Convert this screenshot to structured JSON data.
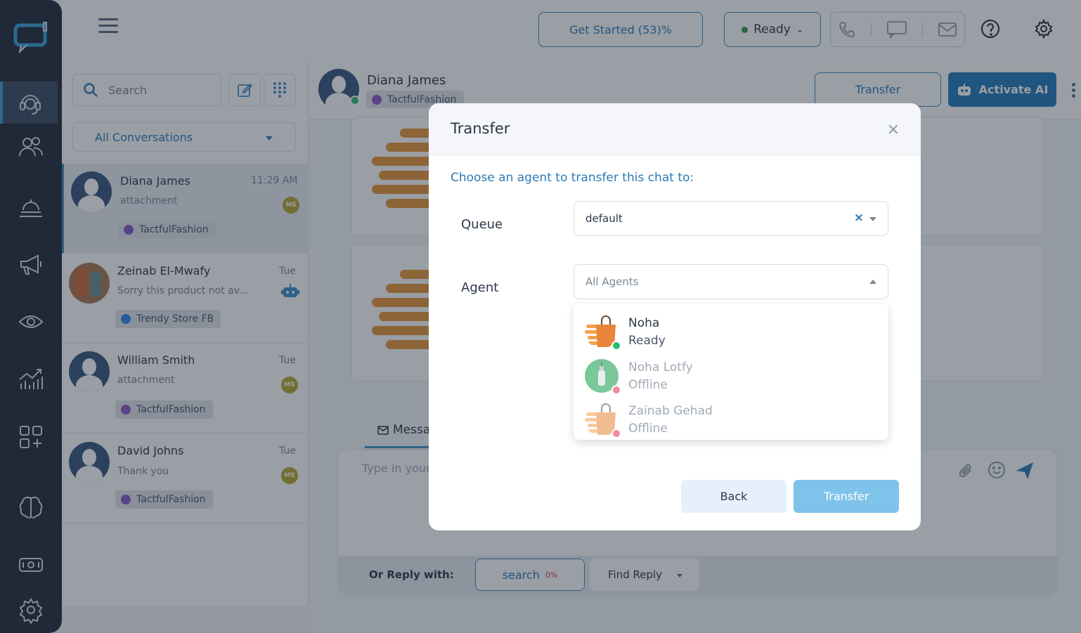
{
  "topbar": {
    "get_started_label": "Get Started (53)%",
    "status_label": "Ready"
  },
  "sidebar": {
    "search_placeholder": "Search",
    "filter_label": "All Conversations"
  },
  "conversations": [
    {
      "name": "Diana James",
      "time": "11:29 AM",
      "preview": "attachment",
      "badge": "MS",
      "channel": "TactfulFashion"
    },
    {
      "name": "Zeinab El-Mwafy",
      "time": "Tue",
      "preview": "Sorry this product not av...",
      "badge": "",
      "channel": "Trendy Store FB"
    },
    {
      "name": "William Smith",
      "time": "Tue",
      "preview": "attachment",
      "badge": "MS",
      "channel": "TactfulFashion"
    },
    {
      "name": "David Johns",
      "time": "Tue",
      "preview": "Thank you",
      "badge": "MS",
      "channel": "TactfulFashion"
    }
  ],
  "chat": {
    "contact_name": "Diana James",
    "contact_channel": "TactfulFashion",
    "transfer_label": "Transfer",
    "activate_ai_label": "Activate AI",
    "message_tab_label": "Messa",
    "composer_placeholder": "Type in your",
    "reply_with_label": "Or Reply with:",
    "search_btn_label": "search",
    "search_pct": "0%",
    "find_reply_label": "Find Reply"
  },
  "modal": {
    "title": "Transfer",
    "close_glyph": "×",
    "subtitle": "Choose an agent to transfer this chat to:",
    "queue_label": "Queue",
    "queue_value": "default",
    "clear_glyph": "×",
    "agent_label": "Agent",
    "agent_placeholder": "All Agents",
    "agents": [
      {
        "name": "Noha",
        "status": "Ready",
        "status_color": "#2bbd6e"
      },
      {
        "name": "Noha Lotfy",
        "status": "Offline",
        "status_color": "#f28b9b"
      },
      {
        "name": "Zainab Gehad",
        "status": "Offline",
        "status_color": "#f28b9b"
      }
    ],
    "back_label": "Back",
    "transfer_label": "Transfer"
  },
  "colors": {
    "accent": "#2c7bb6",
    "rail_bg": "#1f2a3a",
    "primary_button": "#1f7ab8"
  }
}
